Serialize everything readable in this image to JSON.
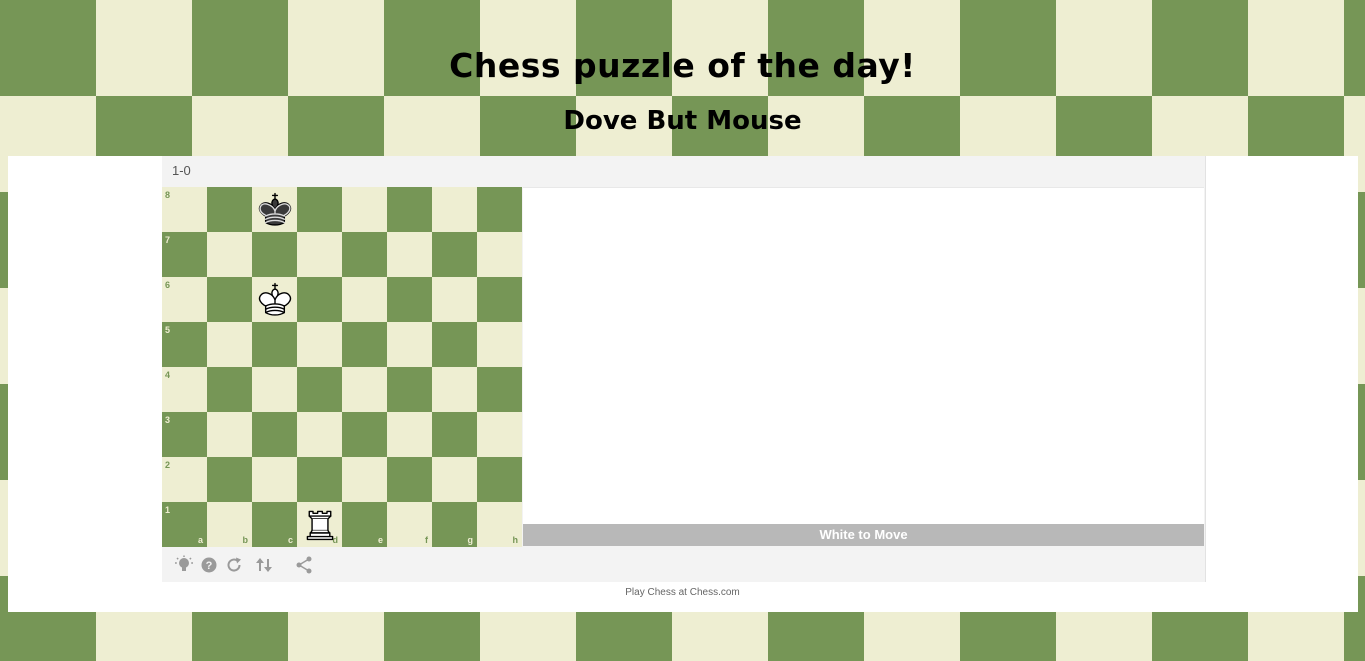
{
  "page": {
    "title": "Chess puzzle of the day!",
    "subtitle": "Dove But Mouse",
    "footer": "Play Chess at Chess.com"
  },
  "puzzle": {
    "result": "1-0",
    "status": "White to Move",
    "ranks": [
      "8",
      "7",
      "6",
      "5",
      "4",
      "3",
      "2",
      "1"
    ],
    "files": [
      "a",
      "b",
      "c",
      "d",
      "e",
      "f",
      "g",
      "h"
    ],
    "pieces": [
      {
        "square": "c8",
        "piece": "black-king"
      },
      {
        "square": "c6",
        "piece": "white-king"
      },
      {
        "square": "d1",
        "piece": "white-rook"
      }
    ]
  },
  "controls": [
    {
      "name": "hint-icon"
    },
    {
      "name": "help-icon"
    },
    {
      "name": "retry-icon"
    },
    {
      "name": "flip-board-icon"
    },
    {
      "name": "share-icon"
    }
  ],
  "colors": {
    "light_square": "#eeeed2",
    "dark_square": "#769656",
    "status_bar": "#b8b8b8"
  }
}
